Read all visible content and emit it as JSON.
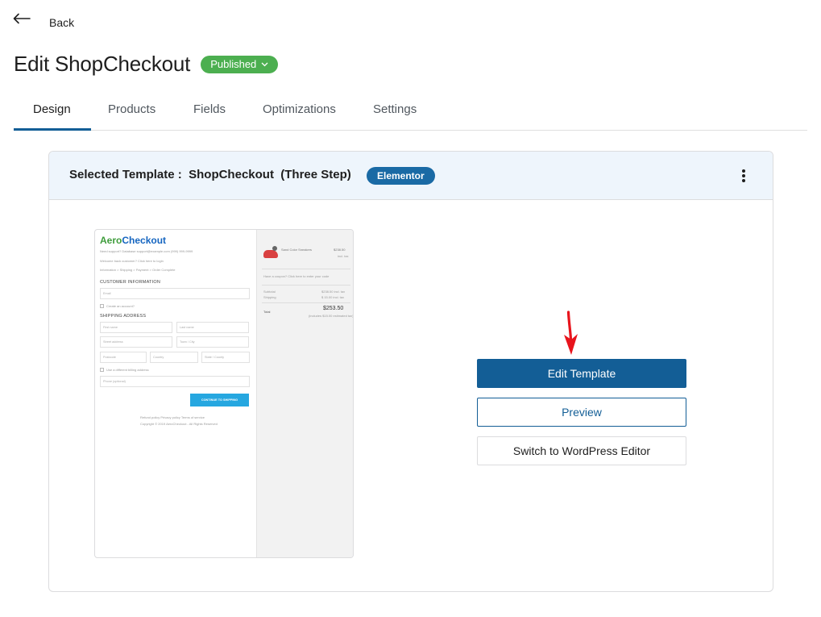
{
  "nav": {
    "back_label": "Back"
  },
  "page": {
    "title": "Edit ShopCheckout",
    "status": "Published"
  },
  "tabs": [
    {
      "label": "Design",
      "active": true
    },
    {
      "label": "Products",
      "active": false
    },
    {
      "label": "Fields",
      "active": false
    },
    {
      "label": "Optimizations",
      "active": false
    },
    {
      "label": "Settings",
      "active": false
    }
  ],
  "card": {
    "header_prefix": "Selected Template :  ",
    "template_name": "ShopCheckout  (Three Step)",
    "builder_badge": "Elementor"
  },
  "preview": {
    "logo_green": "Aero",
    "logo_blue": "Checkout",
    "contact_line": "Need support?   Database   support@example.com   (999) 999-9999",
    "login_line": "Welcome back customer? Click here to login",
    "breadcrumb": "Information > Shipping > Payment > Order Complete",
    "customer_heading": "CUSTOMER INFORMATION",
    "email_placeholder": "Email",
    "create_account": "Create an account?",
    "shipping_heading": "SHIPPING ADDRESS",
    "first_name": "First name",
    "last_name": "Last name",
    "street": "Street address",
    "city": "Town / City",
    "postcode": "Postcode",
    "country": "Country",
    "state": "State / County",
    "different_billing": "Use a different billing address",
    "phone": "Phone (optional)",
    "cta": "CONTINUE TO SHIPPING",
    "footer_links": "Refund policy   Privacy policy   Terms of service",
    "copyright": "Copyright © 2019 AeroCheckout - All Rights Reserved",
    "product_name": "Sand Color Sneakers",
    "product_price": "$238.50",
    "product_tax": "incl. tax",
    "coupon": "Have a coupon? Click here to enter your code",
    "subtotal_label": "Subtotal",
    "subtotal_value": "$238.50 incl. tax",
    "shipping_label": "Shipping",
    "shipping_value": "$ 15.00 incl. tax",
    "total_label": "Total",
    "total_value": "$253.50",
    "total_note": "(includes $15.00 estimated tax)"
  },
  "actions": {
    "edit_template": "Edit Template",
    "preview": "Preview",
    "switch_editor": "Switch to WordPress Editor"
  },
  "colors": {
    "primary": "#135e96",
    "status_green": "#4caf50",
    "badge_blue": "#1a6aa5",
    "arrow_red": "#e8141c"
  }
}
